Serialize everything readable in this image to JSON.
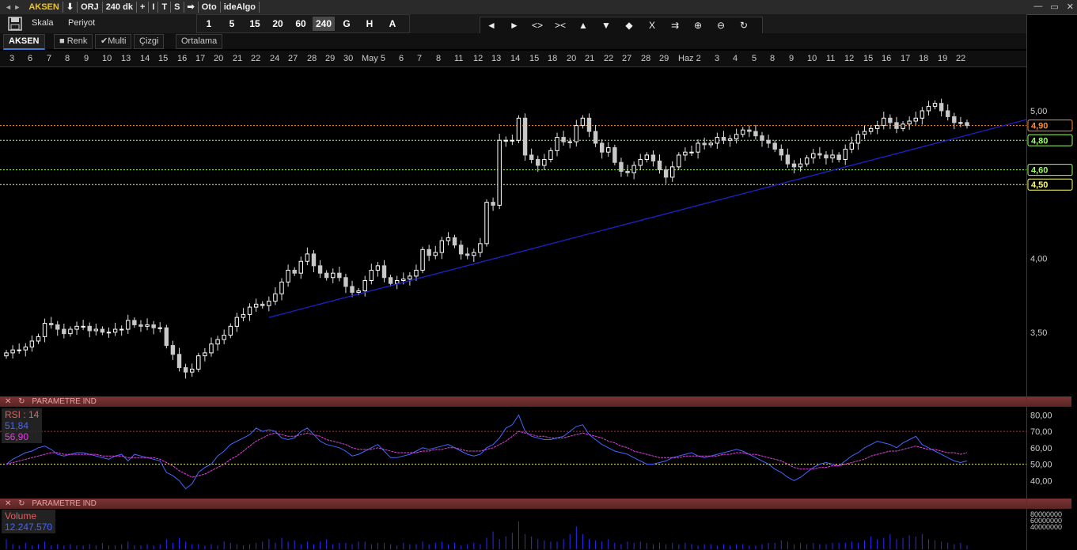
{
  "titlebar": {
    "items": [
      "AKSEN",
      "⬇",
      "ORJ",
      "240 dk",
      "+",
      "I",
      "T",
      "S",
      "➡",
      "Oto",
      "ideAlgo"
    ],
    "window_controls": [
      "—",
      "▭",
      "✕"
    ]
  },
  "toolbar": {
    "scale_label": "Skala",
    "period_label": "Periyot",
    "periods": [
      "1",
      "5",
      "15",
      "20",
      "60",
      "240",
      "G",
      "H",
      "A"
    ],
    "active_period": "240",
    "nav_buttons": [
      "◄",
      "►",
      "<>",
      "><",
      "▲",
      "▼",
      "◆",
      "X",
      "⇉",
      "⊕",
      "⊖",
      "↻"
    ]
  },
  "tabs": [
    {
      "label": "AKSEN",
      "active": true
    },
    {
      "label": "■ Renk",
      "active": false
    },
    {
      "label": "✔Multi",
      "active": false
    },
    {
      "label": "Çizgi",
      "active": false
    },
    {
      "label": "Ortalama",
      "active": false
    }
  ],
  "date_axis": [
    "3",
    "6",
    "7",
    "8",
    "9",
    "10",
    "13",
    "14",
    "15",
    "16",
    "17",
    "20",
    "21",
    "22",
    "24",
    "27",
    "28",
    "29",
    "30",
    "May 5",
    "6",
    "7",
    "8",
    "11",
    "12",
    "13",
    "14",
    "15",
    "18",
    "20",
    "21",
    "22",
    "27",
    "28",
    "29",
    "Haz 2",
    "3",
    "4",
    "5",
    "8",
    "9",
    "10",
    "11",
    "12",
    "15",
    "16",
    "17",
    "18",
    "19",
    "22"
  ],
  "panels": {
    "rsi_header": "PARAMETRE   IND",
    "vol_header": "PARAMETRE   IND",
    "rsi_title": "RSI :  14",
    "rsi_value": "51,84",
    "rsi_avg": "56,90",
    "vol_title": "Volume",
    "vol_value": "12.247.570"
  },
  "colors": {
    "up": "#ffffff",
    "down": "#c8c8c8",
    "trend": "#2020cc",
    "rsi": "#4466ff",
    "rsi_avg": "#e040e0",
    "volume": "#2a2aff"
  },
  "chart_data": [
    {
      "type": "candlestick",
      "yaxis_ticks": [
        "5,00",
        "4,00",
        "3,50"
      ],
      "ylim": [
        3.07,
        5.3
      ],
      "close": [
        3.36,
        3.38,
        3.38,
        3.4,
        3.44,
        3.47,
        3.56,
        3.55,
        3.52,
        3.49,
        3.52,
        3.54,
        3.54,
        3.51,
        3.52,
        3.5,
        3.5,
        3.52,
        3.52,
        3.58,
        3.55,
        3.54,
        3.55,
        3.53,
        3.53,
        3.41,
        3.35,
        3.26,
        3.23,
        3.25,
        3.34,
        3.36,
        3.42,
        3.45,
        3.48,
        3.54,
        3.6,
        3.62,
        3.67,
        3.69,
        3.68,
        3.71,
        3.76,
        3.84,
        3.92,
        3.9,
        3.98,
        4.03,
        3.95,
        3.9,
        3.87,
        3.9,
        3.87,
        3.81,
        3.77,
        3.78,
        3.85,
        3.92,
        3.95,
        3.87,
        3.83,
        3.85,
        3.86,
        3.88,
        3.92,
        4.06,
        4.02,
        4.04,
        4.12,
        4.14,
        4.09,
        4.03,
        4.02,
        4.04,
        4.1,
        4.38,
        4.36,
        4.8,
        4.8,
        4.8,
        4.95,
        4.7,
        4.67,
        4.63,
        4.67,
        4.73,
        4.82,
        4.79,
        4.79,
        4.9,
        4.95,
        4.86,
        4.78,
        4.72,
        4.75,
        4.65,
        4.59,
        4.58,
        4.63,
        4.67,
        4.7,
        4.66,
        4.6,
        4.55,
        4.62,
        4.7,
        4.72,
        4.72,
        4.78,
        4.77,
        4.78,
        4.82,
        4.8,
        4.81,
        4.84,
        4.87,
        4.86,
        4.83,
        4.8,
        4.78,
        4.74,
        4.7,
        4.64,
        4.62,
        4.64,
        4.68,
        4.71,
        4.7,
        4.68,
        4.7,
        4.67,
        4.74,
        4.78,
        4.84,
        4.86,
        4.88,
        4.9,
        4.95,
        4.92,
        4.88,
        4.91,
        4.93,
        4.95,
        5.0,
        5.03,
        5.05,
        5.0,
        4.96,
        4.92,
        4.92,
        4.9
      ],
      "trendline": [
        [
          41,
          3.6
        ],
        [
          152,
          4.92
        ]
      ],
      "hlines": [
        {
          "value": 4.9,
          "label": "4,90",
          "color": "#ff8c3a"
        },
        {
          "value": 4.8,
          "label": "4,80",
          "color": "#9dff6a"
        },
        {
          "value": 4.6,
          "label": "4,60",
          "color": "#9dff6a"
        },
        {
          "value": 4.5,
          "label": "4,50",
          "color": "#ffff70"
        }
      ]
    },
    {
      "type": "line",
      "name": "RSI",
      "yaxis_ticks": [
        "80,00",
        "70,00",
        "60,00",
        "50,00",
        "40,00"
      ],
      "ylim": [
        30,
        85
      ],
      "series": [
        {
          "name": "RSI",
          "values": [
            50,
            53,
            55,
            57,
            58,
            60,
            61,
            59,
            56,
            55,
            56,
            57,
            57,
            56,
            55,
            54,
            53,
            55,
            56,
            52,
            56,
            55,
            54,
            53,
            52,
            45,
            43,
            40,
            35,
            38,
            45,
            48,
            50,
            55,
            58,
            62,
            64,
            66,
            68,
            72,
            70,
            71,
            70,
            66,
            65,
            66,
            70,
            72,
            68,
            64,
            62,
            61,
            60,
            58,
            55,
            56,
            58,
            60,
            62,
            58,
            54,
            54,
            55,
            56,
            58,
            60,
            59,
            60,
            61,
            62,
            60,
            58,
            56,
            55,
            56,
            60,
            62,
            66,
            72,
            74,
            80,
            70,
            67,
            66,
            65,
            65,
            66,
            67,
            70,
            73,
            74,
            68,
            65,
            62,
            60,
            58,
            57,
            56,
            54,
            52,
            50,
            50,
            51,
            52,
            54,
            55,
            56,
            57,
            55,
            54,
            55,
            56,
            57,
            58,
            59,
            58,
            56,
            54,
            52,
            50,
            47,
            45,
            42,
            40,
            42,
            45,
            48,
            50,
            51,
            50,
            49,
            52,
            55,
            57,
            60,
            62,
            64,
            63,
            62,
            60,
            63,
            65,
            67,
            62,
            60,
            58,
            56,
            54,
            52,
            51,
            52
          ]
        },
        {
          "name": "",
          "values": [
            50,
            51,
            52,
            53,
            54,
            55,
            56,
            57,
            57,
            56,
            56,
            56,
            56,
            56,
            56,
            55,
            55,
            55,
            55,
            54,
            54,
            54,
            54,
            54,
            53,
            51,
            49,
            46,
            44,
            42,
            43,
            44,
            46,
            48,
            50,
            53,
            55,
            58,
            61,
            64,
            66,
            68,
            69,
            68,
            67,
            67,
            68,
            69,
            68,
            67,
            65,
            64,
            63,
            62,
            60,
            59,
            59,
            59,
            60,
            59,
            58,
            57,
            57,
            57,
            57,
            58,
            58,
            59,
            59,
            60,
            60,
            59,
            58,
            58,
            58,
            59,
            60,
            62,
            64,
            67,
            70,
            69,
            68,
            67,
            67,
            66,
            66,
            66,
            67,
            68,
            69,
            68,
            67,
            66,
            64,
            63,
            61,
            60,
            58,
            57,
            56,
            55,
            54,
            54,
            54,
            54,
            55,
            55,
            55,
            55,
            55,
            55,
            56,
            56,
            57,
            57,
            56,
            56,
            55,
            54,
            53,
            52,
            50,
            48,
            47,
            47,
            47,
            48,
            48,
            49,
            49,
            50,
            51,
            52,
            53,
            55,
            56,
            57,
            58,
            58,
            59,
            60,
            61,
            60,
            59,
            59,
            58,
            57,
            57,
            56,
            57
          ]
        }
      ],
      "hlines": [
        70,
        50
      ]
    },
    {
      "type": "bar",
      "name": "Volume",
      "yaxis_ticks": [
        "80000000",
        "60000000",
        "40000000"
      ],
      "ylim": [
        0,
        80000000
      ],
      "values": [
        8,
        4,
        3,
        5,
        3,
        4,
        6,
        3,
        4,
        3,
        4,
        3,
        3,
        4,
        3,
        5,
        3,
        3,
        4,
        6,
        3,
        3,
        4,
        3,
        4,
        8,
        5,
        9,
        6,
        4,
        4,
        3,
        4,
        3,
        6,
        5,
        4,
        3,
        4,
        5,
        6,
        8,
        5,
        9,
        6,
        7,
        4,
        6,
        4,
        6,
        8,
        4,
        5,
        5,
        4,
        6,
        6,
        4,
        5,
        5,
        4,
        3,
        5,
        4,
        4,
        6,
        4,
        5,
        6,
        4,
        5,
        3,
        4,
        5,
        4,
        9,
        14,
        8,
        10,
        13,
        22,
        12,
        10,
        8,
        7,
        6,
        6,
        8,
        12,
        18,
        12,
        8,
        7,
        6,
        8,
        5,
        4,
        6,
        5,
        6,
        5,
        4,
        5,
        4,
        5,
        4,
        5,
        4,
        3,
        4,
        4,
        3,
        4,
        3,
        4,
        4,
        3,
        3,
        4,
        5,
        5,
        7,
        6,
        4,
        5,
        4,
        5,
        4,
        4,
        5,
        5,
        5,
        6,
        5,
        7,
        10,
        8,
        9,
        12,
        8,
        9,
        11,
        10,
        12,
        8,
        7,
        6,
        5,
        4,
        5,
        3
      ],
      "unit_scale": 1000000
    }
  ]
}
